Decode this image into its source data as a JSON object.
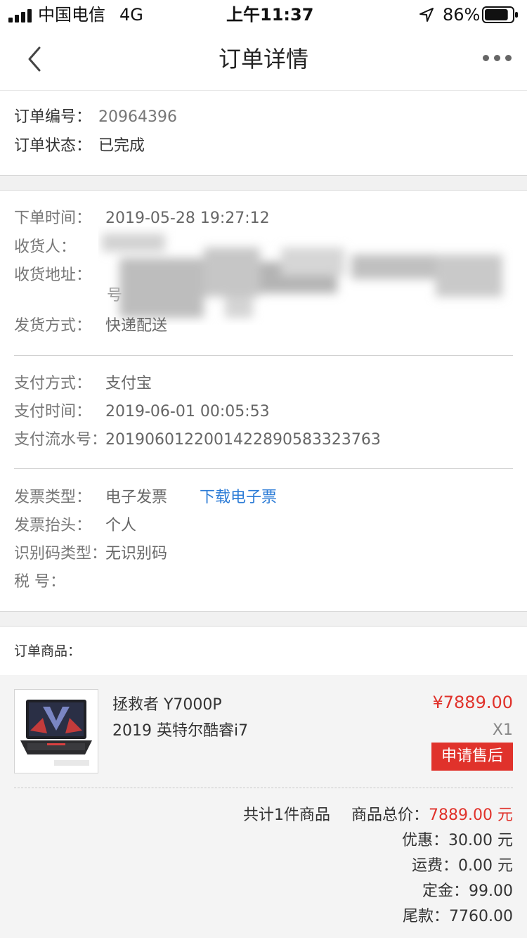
{
  "status_bar": {
    "carrier": "中国电信",
    "network": "4G",
    "time": "上午11:37",
    "battery_percent": "86%",
    "battery_level": 0.86
  },
  "nav": {
    "title": "订单详情"
  },
  "order": {
    "number_label": "订单编号：",
    "number": "20964396",
    "status_label": "订单状态：",
    "status": "已完成"
  },
  "shipping": {
    "time_label": "下单时间：",
    "time": "2019-05-28 19:27:12",
    "receiver_label": "收货人：",
    "address_label": "收货地址：",
    "address_tail": "号",
    "method_label": "发货方式：",
    "method": "快递配送"
  },
  "payment": {
    "method_label": "支付方式：",
    "method": "支付宝",
    "time_label": "支付时间：",
    "time": "2019-06-01 00:05:53",
    "serial_label": "支付流水号：",
    "serial": "2019060122001422890583323763"
  },
  "invoice": {
    "type_label": "发票类型：",
    "type": "电子发票",
    "download_link": "下载电子票",
    "title_label": "发票抬头：",
    "title": "个人",
    "id_type_label": "识别码类型：",
    "id_type": "无识别码",
    "tax_label": "税 号："
  },
  "products": {
    "section_label": "订单商品：",
    "items": [
      {
        "name_line1": "拯救者 Y7000P",
        "name_line2": "2019 英特尔酷睿i7",
        "price": "¥7889.00",
        "qty": "X1",
        "after_sale_button": "申请售后"
      }
    ]
  },
  "summary": {
    "count_text": "共计1件商品",
    "total_label": "商品总价：",
    "total_value": "7889.00 元",
    "discount_label": "优惠：",
    "discount_value": "30.00 元",
    "shipping_label": "运费：",
    "shipping_value": "0.00 元",
    "deposit_label": "定金：",
    "deposit_value": "99.00",
    "balance_label": "尾款：",
    "balance_value": "7760.00"
  },
  "colors": {
    "accent_red": "#e0322b",
    "link_blue": "#2b7bd6"
  }
}
